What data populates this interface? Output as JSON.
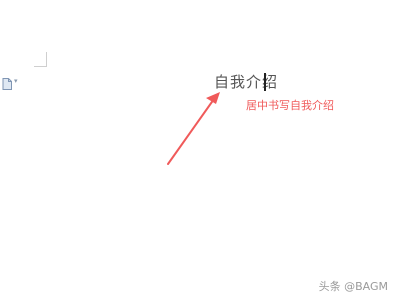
{
  "document": {
    "heading_text": "自我介绍",
    "doc_icon": "document-icon",
    "doc_icon_dropdown": "chevron-down-icon"
  },
  "annotation": {
    "text": "居中书写自我介绍",
    "color": "#f05a5a",
    "arrow_icon": "arrow-icon"
  },
  "watermark": {
    "text": "头条 @BAGM"
  }
}
